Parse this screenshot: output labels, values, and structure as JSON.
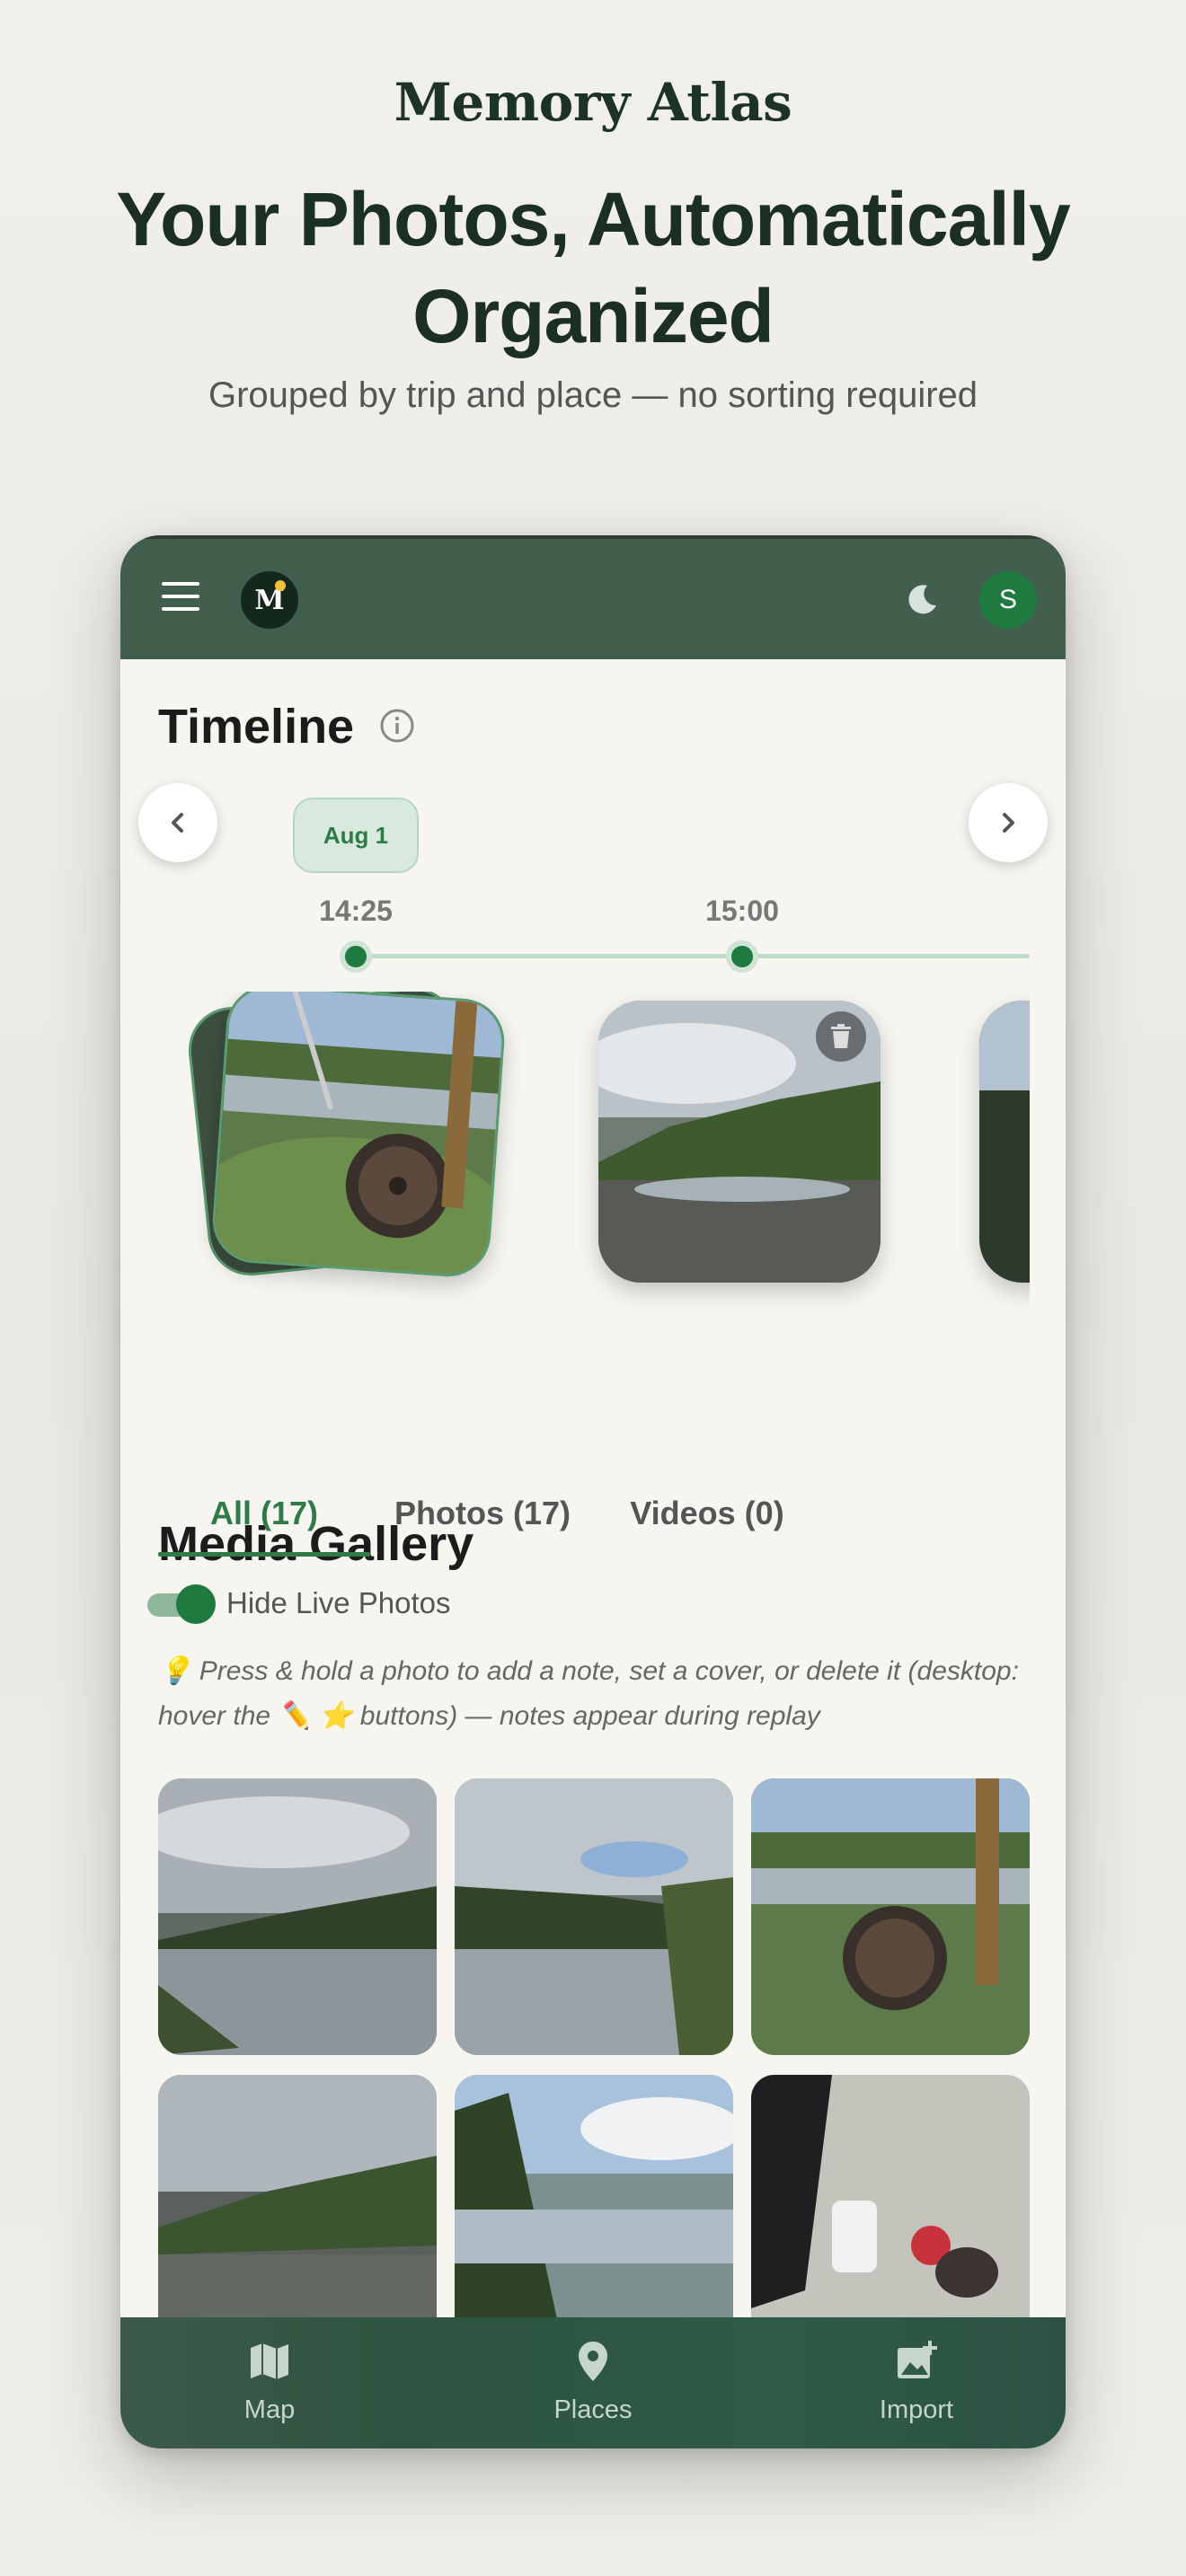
{
  "hero": {
    "brand": "Memory Atlas",
    "headline_line1": "Your Photos, Automatically",
    "headline_line2": "Organized",
    "subhead": "Grouped by trip and place — no sorting required"
  },
  "header": {
    "logo_text": "M",
    "avatar_initial": "S"
  },
  "timeline": {
    "title": "Timeline",
    "date_chip": "Aug 1",
    "times": [
      "14:25",
      "15:00"
    ]
  },
  "gallery": {
    "title": "Media Gallery",
    "tabs": [
      {
        "label": "All (17)",
        "active": true
      },
      {
        "label": "Photos (17)",
        "active": false
      },
      {
        "label": "Videos (0)",
        "active": false
      }
    ],
    "toggle_label": "Hide Live Photos",
    "toggle_on": true,
    "hint": "💡 Press & hold a photo to add a note, set a cover, or delete it (desktop: hover the ✏️ ⭐ buttons) — notes appear during replay"
  },
  "bottom_nav": {
    "items": [
      {
        "label": "Map",
        "icon": "map-icon"
      },
      {
        "label": "Places",
        "icon": "pin-icon"
      },
      {
        "label": "Import",
        "icon": "image-add-icon"
      }
    ]
  },
  "colors": {
    "header_bg": "#425e4d",
    "accent": "#1e7a3e",
    "accent_text": "#2e7b47"
  }
}
